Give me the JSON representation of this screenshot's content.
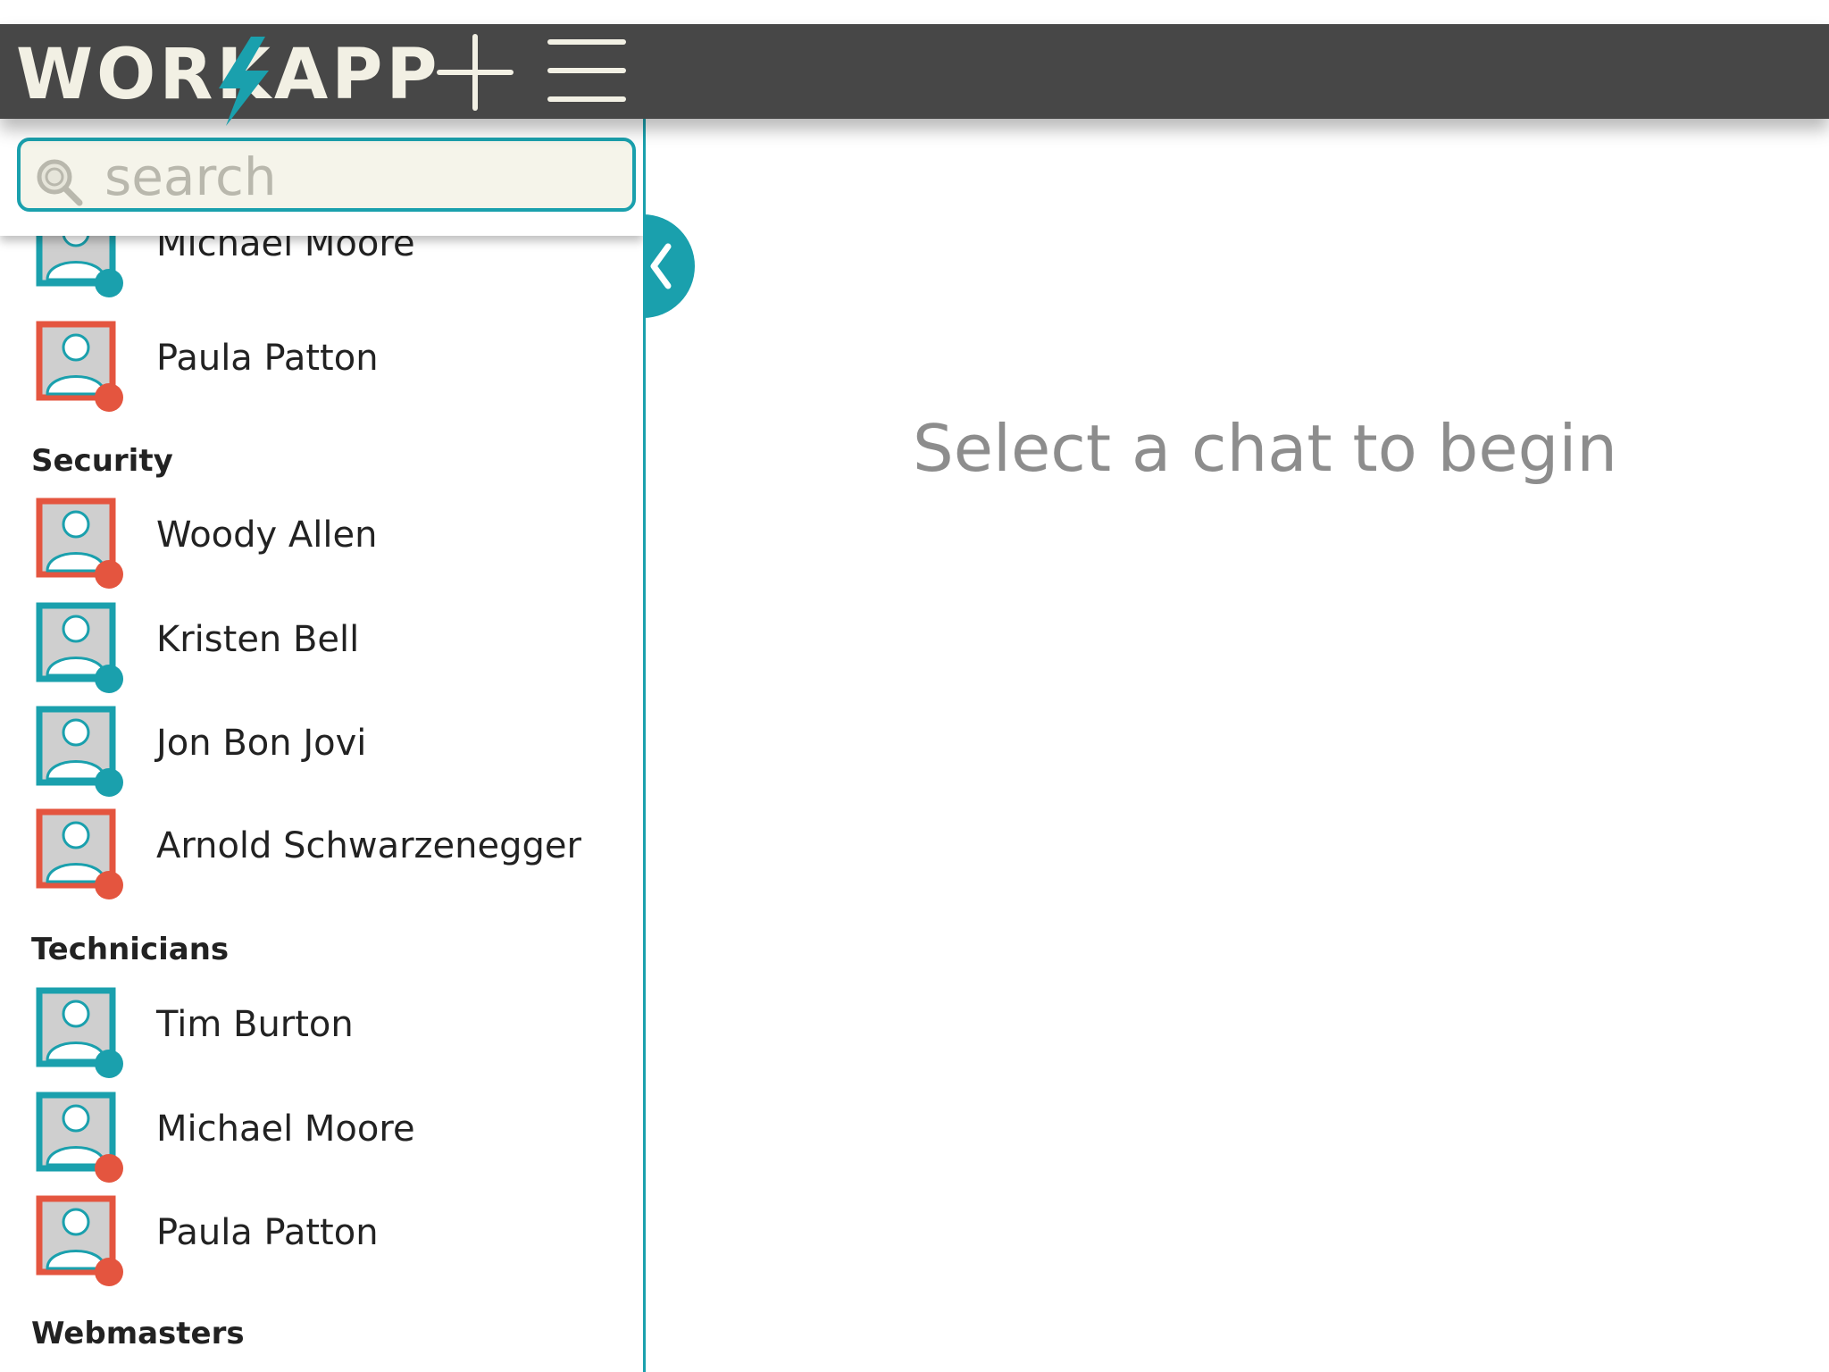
{
  "app": {
    "logo_text": "WORKAPP",
    "add_label": "+",
    "menu_label": "menu"
  },
  "colors": {
    "topbar": "#474747",
    "accent_teal": "#1aa0ad",
    "status_red": "#e4553f",
    "logo_cream": "#f2f0e4"
  },
  "search": {
    "placeholder": "search",
    "value": ""
  },
  "contacts": [
    {
      "type": "contact",
      "name": "Michael Moore",
      "frame": "teal",
      "status": "teal"
    },
    {
      "type": "contact",
      "name": "Paula Patton",
      "frame": "red",
      "status": "red"
    },
    {
      "type": "group",
      "label": "Security"
    },
    {
      "type": "contact",
      "name": "Woody Allen",
      "frame": "red",
      "status": "red"
    },
    {
      "type": "contact",
      "name": "Kristen Bell",
      "frame": "teal",
      "status": "teal"
    },
    {
      "type": "contact",
      "name": "Jon Bon Jovi",
      "frame": "teal",
      "status": "teal"
    },
    {
      "type": "contact",
      "name": "Arnold Schwarzenegger",
      "frame": "red",
      "status": "red"
    },
    {
      "type": "group",
      "label": "Technicians"
    },
    {
      "type": "contact",
      "name": "Tim Burton",
      "frame": "teal",
      "status": "teal"
    },
    {
      "type": "contact",
      "name": "Michael Moore",
      "frame": "teal",
      "status": "red"
    },
    {
      "type": "contact",
      "name": "Paula Patton",
      "frame": "red",
      "status": "red"
    },
    {
      "type": "group",
      "label": "Webmasters"
    }
  ],
  "main": {
    "empty_message": "Select a chat to begin"
  }
}
